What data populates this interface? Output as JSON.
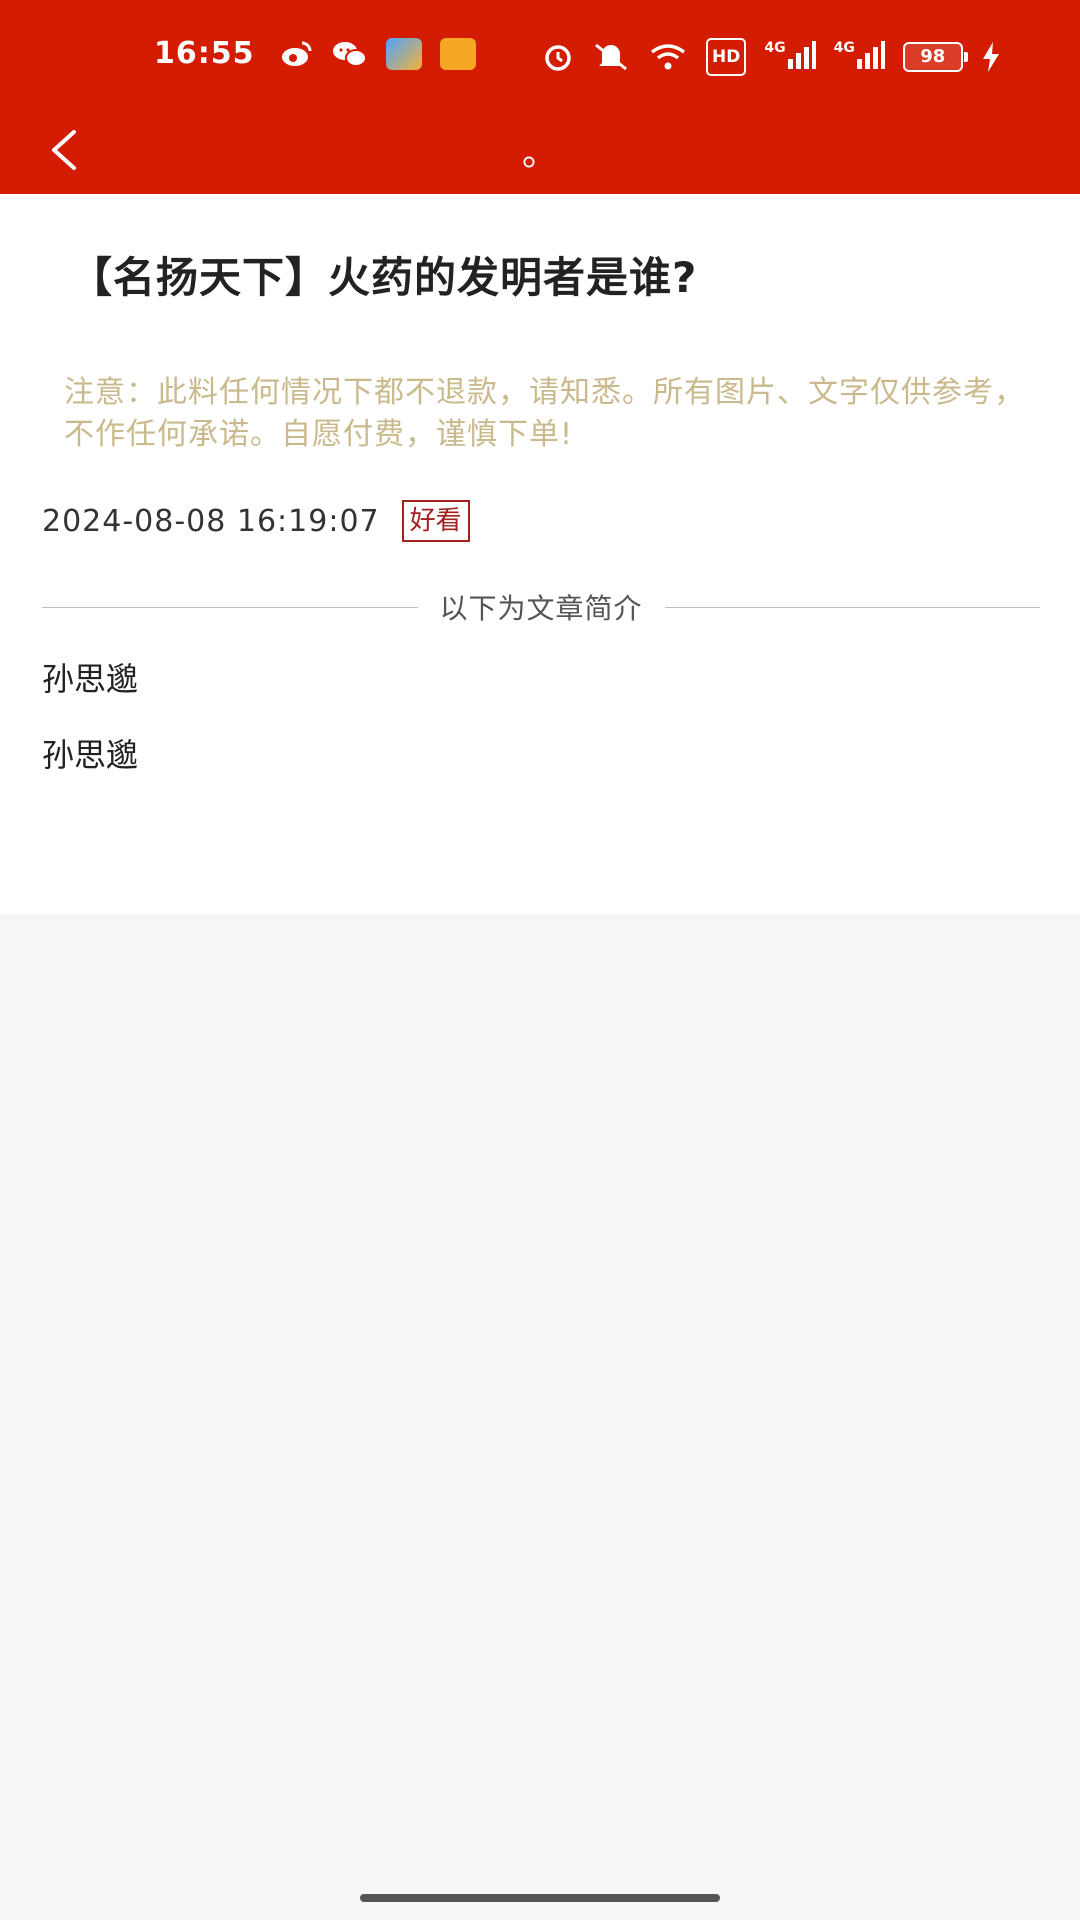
{
  "status_bar": {
    "time": "16:55",
    "battery_level": "98",
    "hd_label": "HD",
    "signal_label_1": "4G",
    "signal_label_2": "4G",
    "icons": [
      "weibo-icon",
      "wechat-icon",
      "app-blue-icon",
      "app-orange-icon",
      "alarm-icon",
      "mute-icon",
      "wifi-icon",
      "hd-icon",
      "signal-icon",
      "signal-icon",
      "battery-icon",
      "charging-icon"
    ]
  },
  "nav": {
    "title": "。"
  },
  "article": {
    "title": "【名扬天下】火药的发明者是谁?",
    "notice": "注意：此料任何情况下都不退款，请知悉。所有图片、文字仅供参考，不作任何承诺。自愿付费，谨慎下单!",
    "time": "2024-08-08 16:19:07",
    "tag": "好看",
    "divider_label": "以下为文章简介",
    "summary_lines": [
      "孙思邈",
      "孙思邈"
    ]
  },
  "colors": {
    "header": "#d41c02",
    "notice": "#c9b98c",
    "tag": "#a32020",
    "page_bg": "#f5f6f8"
  }
}
